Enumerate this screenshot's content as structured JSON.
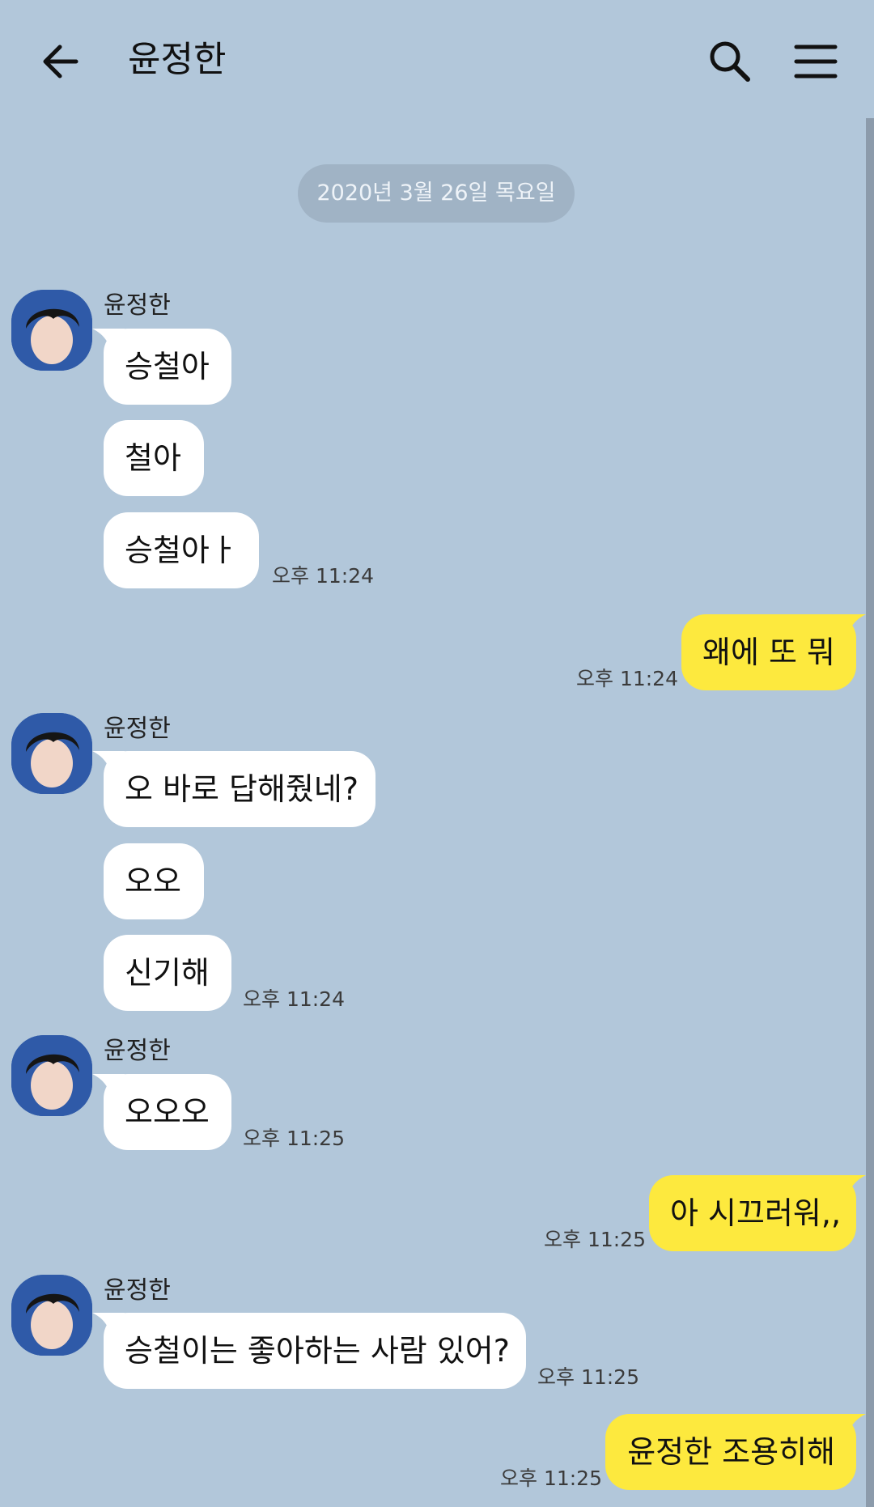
{
  "header": {
    "title": "윤정한"
  },
  "date_divider": "2020년 3월 26일 목요일",
  "messages": {
    "g1": {
      "sender": "윤정한",
      "b1": "승철아",
      "b2": "철아",
      "b3": "승철아ㅏ",
      "time": "오후 11:24"
    },
    "o1": {
      "text": "왜에 또 뭐",
      "time": "오후 11:24"
    },
    "g2": {
      "sender": "윤정한",
      "b1": "오 바로 답해줬네?",
      "b2": "오오",
      "b3": "신기해",
      "time": "오후 11:24"
    },
    "g3": {
      "sender": "윤정한",
      "b1": "오오오",
      "time": "오후 11:25"
    },
    "o2": {
      "text": "아 시끄러워,,",
      "time": "오후 11:25"
    },
    "g4": {
      "sender": "윤정한",
      "b1": "승철이는 좋아하는 사람 있어?",
      "time": "오후 11:25"
    },
    "o3": {
      "text": "윤정한 조용히해",
      "time": "오후 11:25"
    }
  },
  "colors": {
    "background": "#b2c7da",
    "incoming_bubble": "#ffffff",
    "outgoing_bubble": "#fde93e",
    "date_pill": "#a0b3c5"
  },
  "icons": [
    "back-arrow-icon",
    "search-icon",
    "menu-icon",
    "avatar"
  ]
}
